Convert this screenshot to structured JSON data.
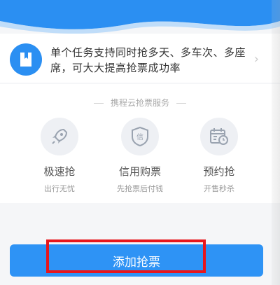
{
  "info": {
    "text": "单个任务支持同时抢多天、多车次、多座席，可大大提高抢票成功率",
    "icon": "ticket-icon"
  },
  "services": {
    "title": "携程云抢票服务",
    "items": [
      {
        "title": "极速抢",
        "subtitle": "出行无忧",
        "icon": "rocket-icon"
      },
      {
        "title": "信用购票",
        "subtitle": "先抢票后付钱",
        "icon": "shield-icon",
        "icon_char": "信"
      },
      {
        "title": "预约抢",
        "subtitle": "开售秒杀",
        "icon": "calendar-clock-icon"
      }
    ]
  },
  "action": {
    "label": "添加抢票"
  },
  "colors": {
    "accent": "#2e93f5",
    "highlight": "#e8161c"
  }
}
